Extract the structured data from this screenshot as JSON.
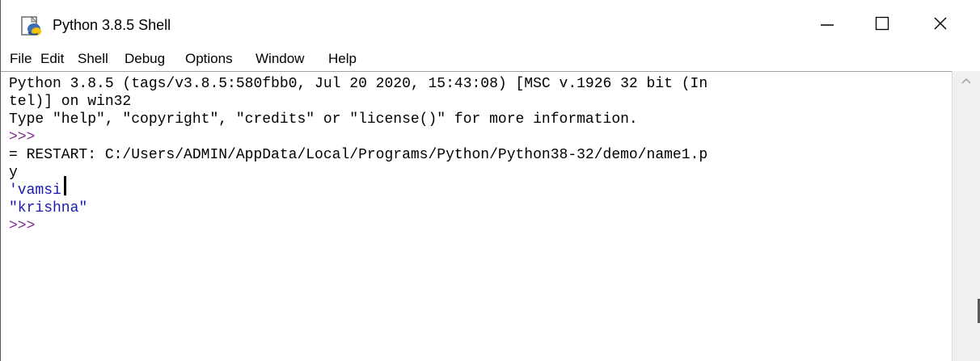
{
  "window": {
    "title": "Python 3.8.5 Shell",
    "controls": {
      "minimize": "minimize",
      "maximize": "maximize",
      "close": "close"
    }
  },
  "menu": [
    "File",
    "Edit",
    "Shell",
    "Debug",
    "Options",
    "Window",
    "Help"
  ],
  "shell": {
    "banner_line1": "Python 3.8.5 (tags/v3.8.5:580fbb0, Jul 20 2020, 15:43:08) [MSC v.1926 32 bit (In",
    "banner_line2": "tel)] on win32",
    "banner_line3": "Type \"help\", \"copyright\", \"credits\" or \"license()\" for more information.",
    "prompt1": ">>> ",
    "restart_line1": "= RESTART: C:/Users/ADMIN/AppData/Local/Programs/Python/Python38-32/demo/name1.p",
    "restart_line2": "y",
    "output1": "'vamsi'",
    "output2": "\"krishna\"",
    "prompt2": ">>> "
  },
  "colors": {
    "prompt": "#7f2f8f",
    "string_output": "#1a1aaf",
    "text": "#000000"
  }
}
